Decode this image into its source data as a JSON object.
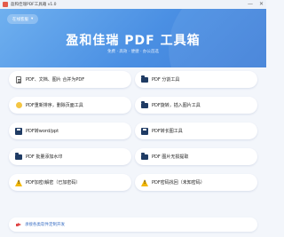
{
  "window": {
    "title": "盈和佳瑞PDF工具箱 v1.0",
    "minimize_glyph": "—",
    "close_glyph": "✕"
  },
  "hero": {
    "button_label": "在线客服",
    "title": "盈和佳瑞 PDF 工具箱",
    "subtitle": "免费 · 高效 · 便捷 · 办公首选"
  },
  "tools": [
    {
      "label": "PDF、文档、图片 合并为PDF",
      "icon": "document-icon"
    },
    {
      "label": "PDF 分割工具",
      "icon": "folder-icon"
    },
    {
      "label": "PDF重新排序，删除页面工具",
      "icon": "sun-icon"
    },
    {
      "label": "PDF旋转，插入图片工具",
      "icon": "folder-icon"
    },
    {
      "label": "PDF转word/ppt",
      "icon": "floppy-icon"
    },
    {
      "label": "PDF转长图工具",
      "icon": "floppy-icon"
    },
    {
      "label": "PDF 批量添加水印",
      "icon": "folder-icon"
    },
    {
      "label": "PDF 图片无损提取",
      "icon": "folder-icon"
    },
    {
      "label": "PDF加密/解密（已加密码）",
      "icon": "warning-icon"
    },
    {
      "label": "PDF密码找回（未知密码）",
      "icon": "warning-icon"
    }
  ],
  "footer": {
    "text": "承接各类软件定制开发"
  },
  "colors": {
    "hero_start": "#6fb0ef",
    "hero_end": "#3f7fd8",
    "footer_text": "#3a6fc4",
    "warning": "#f2b705"
  }
}
